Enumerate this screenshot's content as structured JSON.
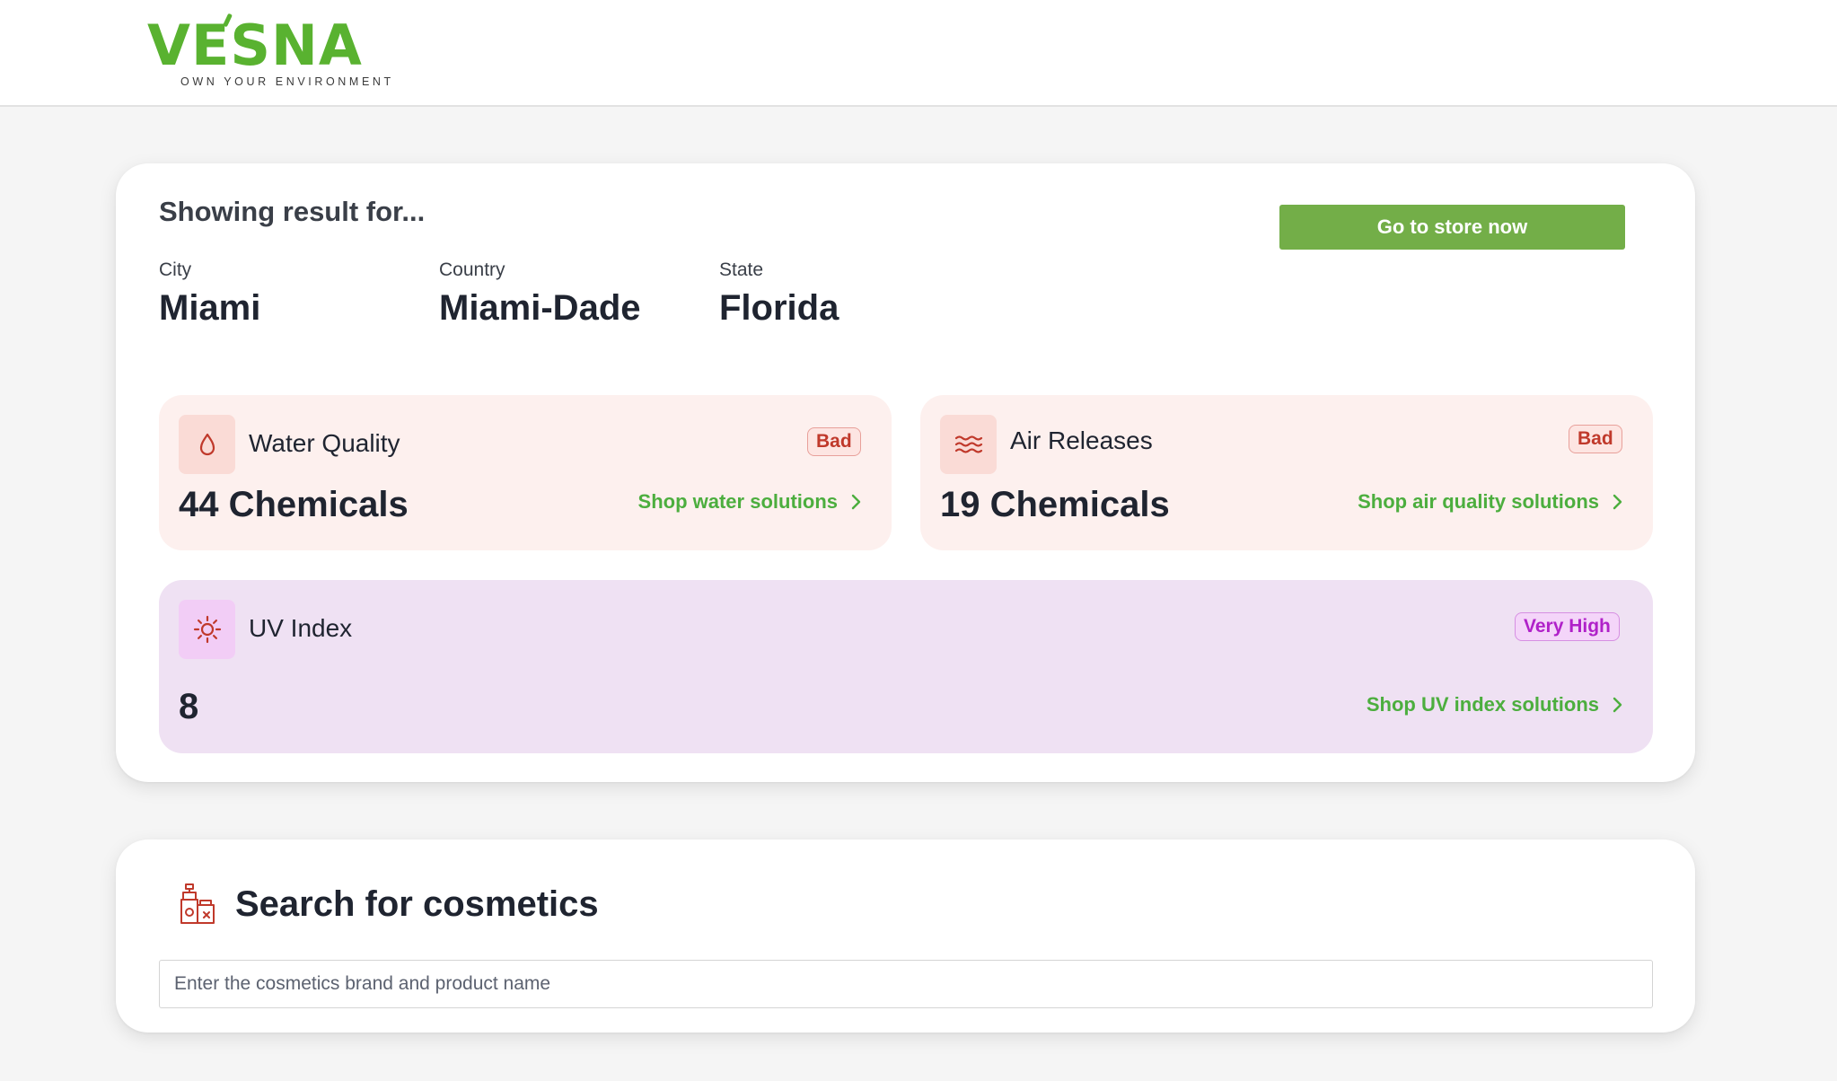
{
  "brand": {
    "name": "VESNA",
    "tagline": "OWN YOUR ENVIRONMENT",
    "color": "#59b230"
  },
  "results": {
    "heading": "Showing result for...",
    "store_button": "Go to store now",
    "location": [
      {
        "label": "City",
        "value": "Miami"
      },
      {
        "label": "Country",
        "value": "Miami-Dade"
      },
      {
        "label": "State",
        "value": "Florida"
      }
    ],
    "metrics": {
      "water": {
        "title": "Water Quality",
        "status": "Bad",
        "value": "44 Chemicals",
        "link": "Shop water solutions",
        "icon": "water-drop-icon"
      },
      "air": {
        "title": "Air Releases",
        "status": "Bad",
        "value": "19 Chemicals",
        "link": "Shop air quality solutions",
        "icon": "air-waves-icon"
      },
      "uv": {
        "title": "UV Index",
        "status": "Very High",
        "value": "8",
        "link": "Shop UV index solutions",
        "icon": "sun-icon"
      }
    }
  },
  "search": {
    "title": "Search for cosmetics",
    "placeholder": "Enter the cosmetics brand and product name",
    "value": "",
    "icon": "cosmetics-icon"
  },
  "colors": {
    "accent_green": "#73ae48",
    "link_green": "#4cae3e",
    "bad_red": "#c0392b",
    "very_high_purple": "#b021c9"
  }
}
